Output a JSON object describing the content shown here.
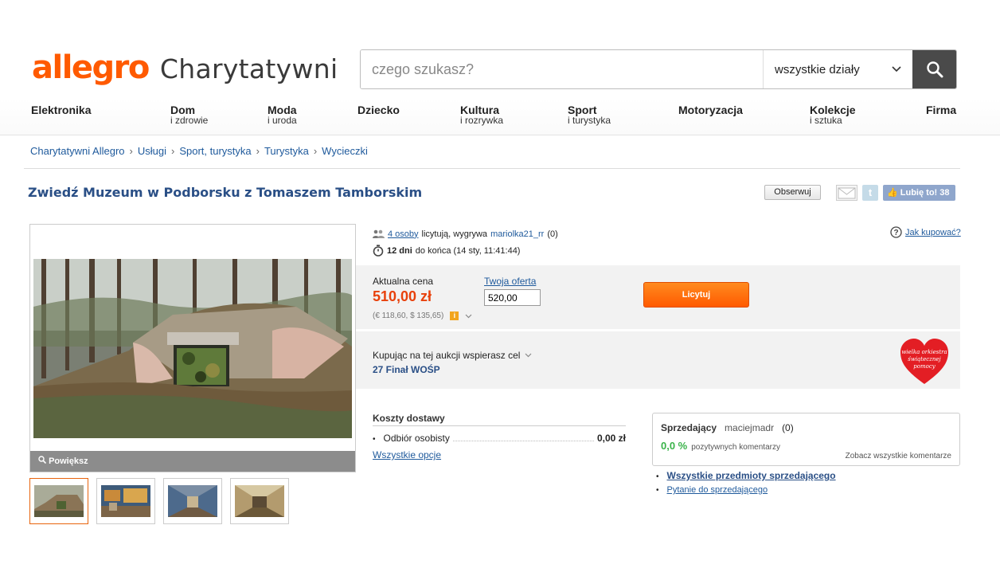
{
  "header": {
    "brand": "allegro",
    "sub_brand": "Charytatywni",
    "search_placeholder": "czego szukasz?",
    "category_select": "wszystkie działy",
    "accent_color": "#ff5a00"
  },
  "nav": [
    {
      "main": "Elektronika",
      "sub": ""
    },
    {
      "main": "Dom",
      "sub": "i zdrowie"
    },
    {
      "main": "Moda",
      "sub": "i uroda"
    },
    {
      "main": "Dziecko",
      "sub": ""
    },
    {
      "main": "Kultura",
      "sub": "i rozrywka"
    },
    {
      "main": "Sport",
      "sub": "i turystyka"
    },
    {
      "main": "Motoryzacja",
      "sub": ""
    },
    {
      "main": "Kolekcje",
      "sub": "i sztuka"
    },
    {
      "main": "Firma",
      "sub": ""
    }
  ],
  "breadcrumbs": [
    "Charytatywni Allegro",
    "Usługi",
    "Sport, turystyka",
    "Turystyka",
    "Wycieczki"
  ],
  "breadcrumb_sep": "›",
  "title": "Zwiedź Muzeum w Podborsku z Tomaszem Tamborskim",
  "actions": {
    "observe": "Obserwuj",
    "like": "Lubię to!",
    "like_count": "38",
    "twitter": "t"
  },
  "gallery": {
    "zoom_label": "Powiększ",
    "thumb_count": 4
  },
  "bid": {
    "bidders_link": "4 osoby",
    "bidding_text": "licytują, wygrywa",
    "winner": "mariolka21_rr",
    "winner_rating": "(0)",
    "days": "12 dni",
    "time_text": "do końca (14 sty, 11:41:44)",
    "how_to_buy": "Jak kupować?"
  },
  "price": {
    "label": "Aktualna cena",
    "value": "510,00 zł",
    "converted": "(€ 118,60, $ 135,65)",
    "your_offer_label": "Twoja oferta",
    "your_offer_value": "520,00",
    "bid_button": "Licytuj"
  },
  "cause": {
    "text": "Kupując na tej aukcji wspierasz cel",
    "name": "27 Finał WOŚP",
    "logo_text": "wielka orkiestra świątecznej pomocy"
  },
  "shipping": {
    "heading": "Koszty dostawy",
    "option": "Odbiór osobisty",
    "price": "0,00 zł",
    "all_options": "Wszystkie opcje"
  },
  "seller": {
    "label": "Sprzedający",
    "name": "maciejmadr",
    "rating": "(0)",
    "positive_pct": "0,0 %",
    "positive_text": "pozytywnych komentarzy",
    "see_comments": "Zobacz wszystkie komentarze",
    "all_items": "Wszystkie przedmioty sprzedającego",
    "ask": "Pytanie do sprzedającego"
  }
}
